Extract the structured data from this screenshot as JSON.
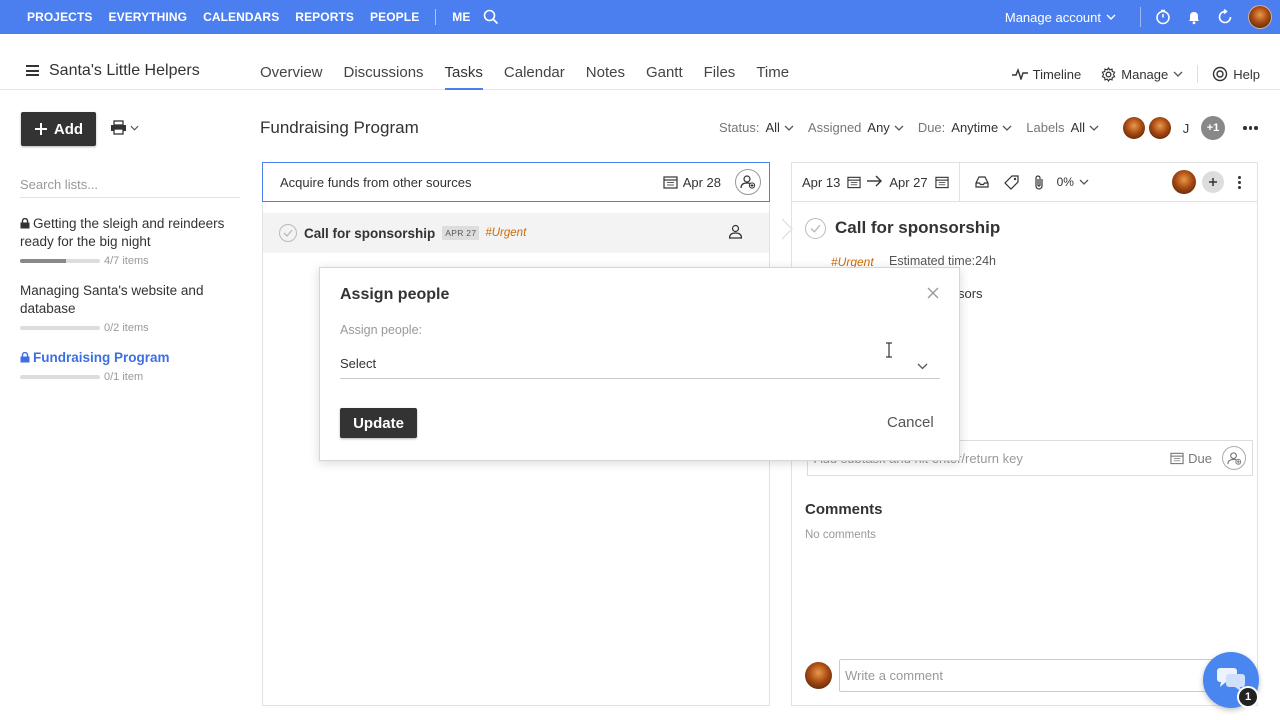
{
  "topnav": {
    "items": [
      "PROJECTS",
      "EVERYTHING",
      "CALENDARS",
      "REPORTS",
      "PEOPLE"
    ],
    "me": "ME",
    "manage_account": "Manage account"
  },
  "project": {
    "title": "Santa's Little Helpers",
    "tabs": [
      "Overview",
      "Discussions",
      "Tasks",
      "Calendar",
      "Notes",
      "Gantt",
      "Files",
      "Time"
    ],
    "active_tab": "Tasks",
    "right_buttons": {
      "timeline": "Timeline",
      "manage": "Manage",
      "help": "Help"
    }
  },
  "sidebar": {
    "add_label": "Add",
    "search_placeholder": "Search lists...",
    "lists": [
      {
        "title": "Getting the sleigh and reindeers ready for the big night",
        "count": "4/7 items",
        "progress": 0.57,
        "locked": true,
        "active": false
      },
      {
        "title": "Managing Santa's website and database",
        "count": "0/2 items",
        "progress": 0,
        "locked": false,
        "active": false
      },
      {
        "title": "Fundraising Program",
        "count": "0/1 item",
        "progress": 0,
        "locked": true,
        "active": true
      }
    ]
  },
  "list": {
    "title": "Fundraising Program",
    "filters": {
      "status_label": "Status:",
      "status_value": "All",
      "assigned_label": "Assigned",
      "assigned_value": "Any",
      "due_label": "Due:",
      "due_value": "Anytime",
      "labels_label": "Labels",
      "labels_value": "All"
    },
    "people": {
      "initial": "J",
      "more": "+1"
    },
    "new_task": {
      "text": "Acquire funds from other sources",
      "date": "Apr 28"
    },
    "tasks": [
      {
        "name": "Call for sponsorship",
        "due": "APR 27",
        "label": "#Urgent"
      }
    ]
  },
  "detail": {
    "start": "Apr 13",
    "end": "Apr 27",
    "progress": "0%",
    "title": "Call for sponsorship",
    "label": "#Urgent",
    "estimated": "Estimated time:24h",
    "description_fragment": "sors",
    "subtask_placeholder": "Add subtask and hit enter/return key",
    "subtask_due": "Due",
    "comments_heading": "Comments",
    "no_comments": "No comments",
    "comment_placeholder": "Write a comment"
  },
  "chat": {
    "badge": "1"
  },
  "modal": {
    "title": "Assign people",
    "label": "Assign people:",
    "select_value": "Select",
    "update": "Update",
    "cancel": "Cancel"
  },
  "colors": {
    "brand": "#4b7ff0",
    "urgent": "#d06a00",
    "dark_button": "#333333"
  }
}
